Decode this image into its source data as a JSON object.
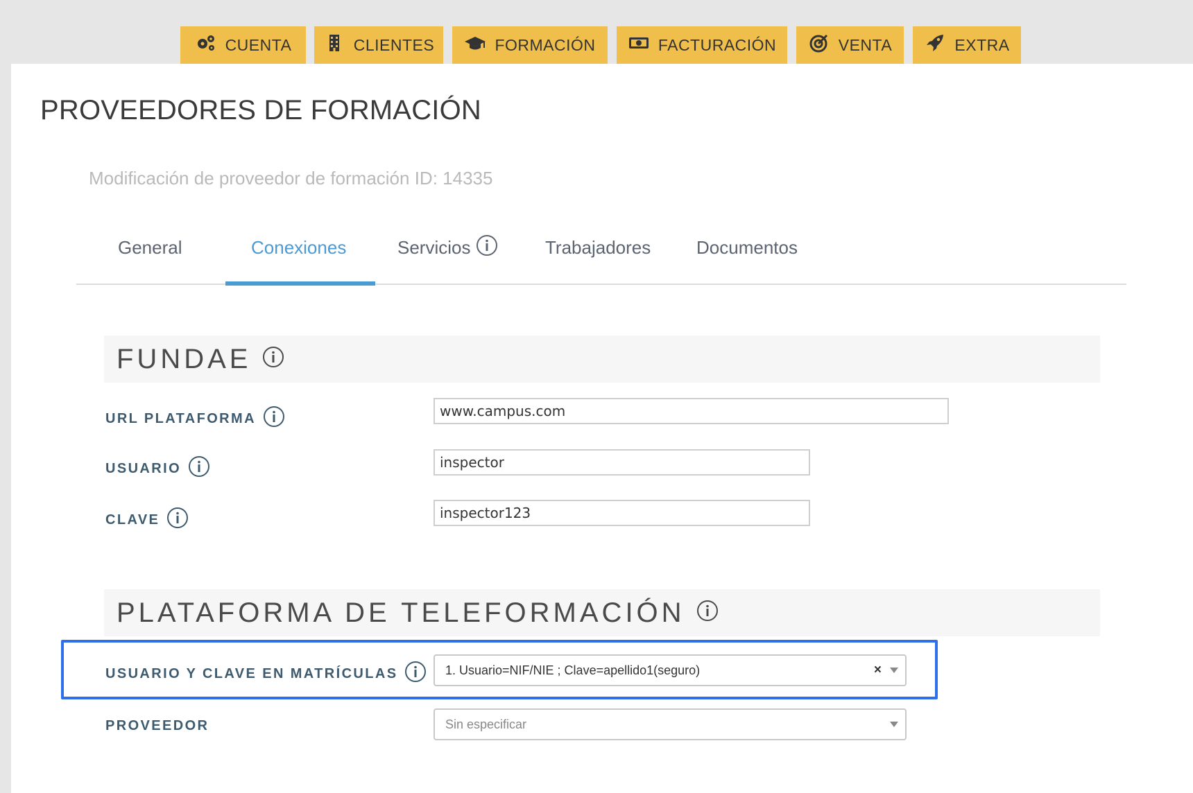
{
  "nav": {
    "items": [
      {
        "label": "CUENTA",
        "icon": "gears-icon"
      },
      {
        "label": "CLIENTES",
        "icon": "building-icon"
      },
      {
        "label": "FORMACIÓN",
        "icon": "graduation-cap-icon"
      },
      {
        "label": "FACTURACIÓN",
        "icon": "money-bill-icon"
      },
      {
        "label": "VENTA",
        "icon": "target-icon"
      },
      {
        "label": "EXTRA",
        "icon": "rocket-icon"
      }
    ],
    "color": "#f0be4a"
  },
  "page": {
    "title": "PROVEEDORES DE FORMACIÓN",
    "subtitle": "Modificación de proveedor de formación ID: 14335"
  },
  "tabs": [
    {
      "label": "General",
      "active": false
    },
    {
      "label": "Conexiones",
      "active": true
    },
    {
      "label": "Servicios",
      "active": false,
      "icon": "info-icon"
    },
    {
      "label": "Trabajadores",
      "active": false
    },
    {
      "label": "Documentos",
      "active": false
    }
  ],
  "fundae": {
    "title": "FUNDAE",
    "fields": {
      "url": {
        "label": "URL PLATAFORMA",
        "value": "www.campus.com"
      },
      "usuario": {
        "label": "USUARIO",
        "value": "inspector"
      },
      "clave": {
        "label": "CLAVE",
        "value": "inspector123"
      }
    }
  },
  "teleformacion": {
    "title": "PLATAFORMA DE TELEFORMACIÓN",
    "fields": {
      "matriculas": {
        "label": "USUARIO Y CLAVE EN MATRÍCULAS",
        "value": "1. Usuario=NIF/NIE ; Clave=apellido1(seguro)",
        "clear": "×"
      },
      "proveedor": {
        "label": "PROVEEDOR",
        "placeholder": "Sin especificar"
      }
    }
  },
  "colors": {
    "accent": "#4a9ad4",
    "highlight": "#2f6fe8",
    "label": "#3e5a6e"
  }
}
